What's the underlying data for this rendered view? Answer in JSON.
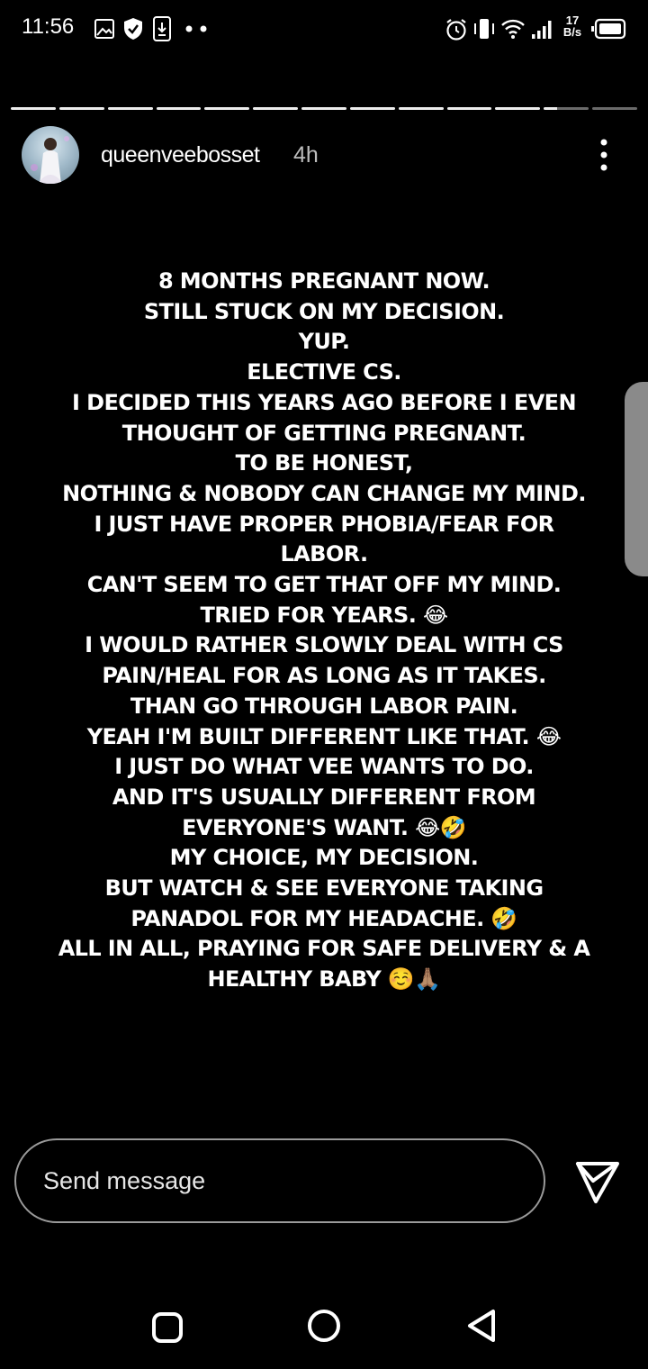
{
  "status_bar": {
    "time": "11:56",
    "net_speed_value": "17",
    "net_speed_unit": "B/s",
    "left_icons": [
      "gallery-icon",
      "shield-check-icon",
      "download-icon",
      "more-dots-icon"
    ],
    "right_icons": [
      "alarm-icon",
      "vibrate-icon",
      "wifi-icon",
      "signal-icon",
      "battery-icon"
    ]
  },
  "story": {
    "segments_total": 13,
    "segments_complete": 11,
    "current_segment_progress": 0.3,
    "username": "queenveebosset",
    "time_ago": "4h",
    "lines": [
      "8  MONTHS PREGNANT NOW.",
      "STILL STUCK ON MY DECISION.",
      "YUP.",
      "ELECTIVE CS.",
      "I DECIDED THIS YEARS AGO BEFORE I EVEN",
      "THOUGHT OF GETTING PREGNANT.",
      "TO BE HONEST,",
      "NOTHING & NOBODY CAN CHANGE MY MIND.",
      "I JUST HAVE PROPER PHOBIA/FEAR FOR",
      "LABOR.",
      "CAN'T SEEM TO GET THAT OFF MY MIND.",
      "TRIED FOR YEARS. 😂",
      "I WOULD RATHER SLOWLY DEAL WITH CS",
      "PAIN/HEAL FOR AS LONG AS IT TAKES.",
      "THAN GO THROUGH LABOR PAIN.",
      "YEAH I'M BUILT DIFFERENT LIKE THAT. 😂",
      "I JUST DO WHAT VEE WANTS TO DO.",
      "AND IT'S USUALLY DIFFERENT FROM",
      "EVERYONE'S WANT. 😂🤣",
      "MY CHOICE, MY DECISION.",
      "BUT WATCH  & SEE EVERYONE TAKING",
      "PANADOL FOR MY HEADACHE. 🤣",
      "ALL IN ALL, PRAYING FOR SAFE DELIVERY & A",
      "HEALTHY BABY ☺️🙏🏽"
    ]
  },
  "reply": {
    "placeholder": "Send message"
  },
  "nav": {
    "buttons": [
      "recents-square-icon",
      "home-circle-icon",
      "back-triangle-icon"
    ]
  }
}
